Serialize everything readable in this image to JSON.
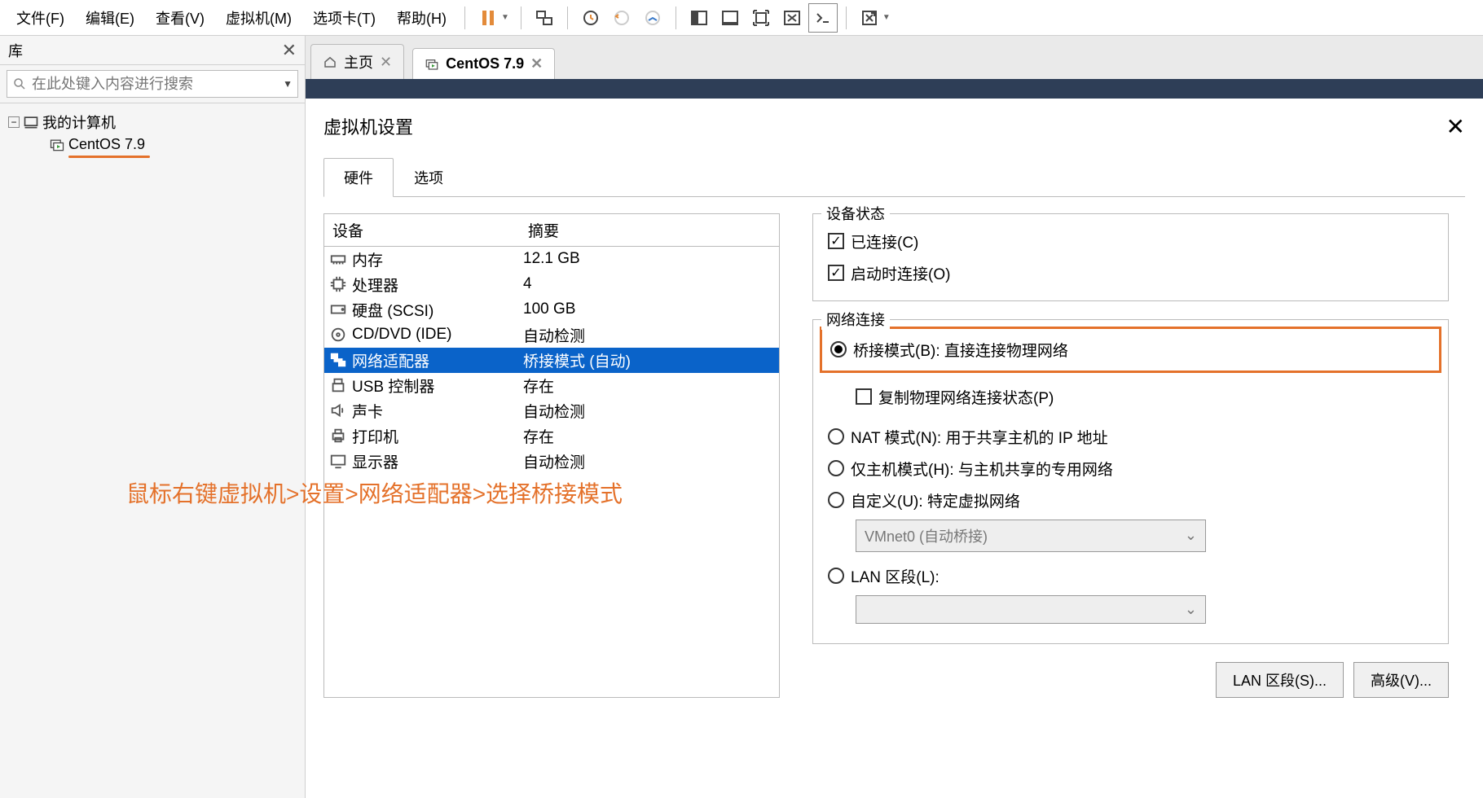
{
  "menu": {
    "items": [
      "文件(F)",
      "编辑(E)",
      "查看(V)",
      "虚拟机(M)",
      "选项卡(T)",
      "帮助(H)"
    ]
  },
  "sidebar": {
    "title": "库",
    "search_placeholder": "在此处键入内容进行搜索",
    "root": "我的计算机",
    "child": "CentOS 7.9"
  },
  "tabs": {
    "home": "主页",
    "vm": "CentOS 7.9"
  },
  "dialog": {
    "title": "虚拟机设置",
    "tab_hw": "硬件",
    "tab_opt": "选项",
    "col_device": "设备",
    "col_summary": "摘要",
    "rows": [
      {
        "name": "内存",
        "summary": "12.1 GB"
      },
      {
        "name": "处理器",
        "summary": "4"
      },
      {
        "name": "硬盘 (SCSI)",
        "summary": "100 GB"
      },
      {
        "name": "CD/DVD (IDE)",
        "summary": "自动检测"
      },
      {
        "name": "网络适配器",
        "summary": "桥接模式 (自动)"
      },
      {
        "name": "USB 控制器",
        "summary": "存在"
      },
      {
        "name": "声卡",
        "summary": "自动检测"
      },
      {
        "name": "打印机",
        "summary": "存在"
      },
      {
        "name": "显示器",
        "summary": "自动检测"
      }
    ],
    "status_title": "设备状态",
    "connected": "已连接(C)",
    "connect_on_power": "启动时连接(O)",
    "net_title": "网络连接",
    "bridged": "桥接模式(B): 直接连接物理网络",
    "replicate": "复制物理网络连接状态(P)",
    "nat": "NAT 模式(N): 用于共享主机的 IP 地址",
    "hostonly": "仅主机模式(H): 与主机共享的专用网络",
    "custom": "自定义(U): 特定虚拟网络",
    "custom_value": "VMnet0 (自动桥接)",
    "lan": "LAN 区段(L):",
    "btn_lan": "LAN 区段(S)...",
    "btn_adv": "高级(V)..."
  },
  "annotation": "鼠标右键虚拟机>设置>网络适配器>选择桥接模式"
}
